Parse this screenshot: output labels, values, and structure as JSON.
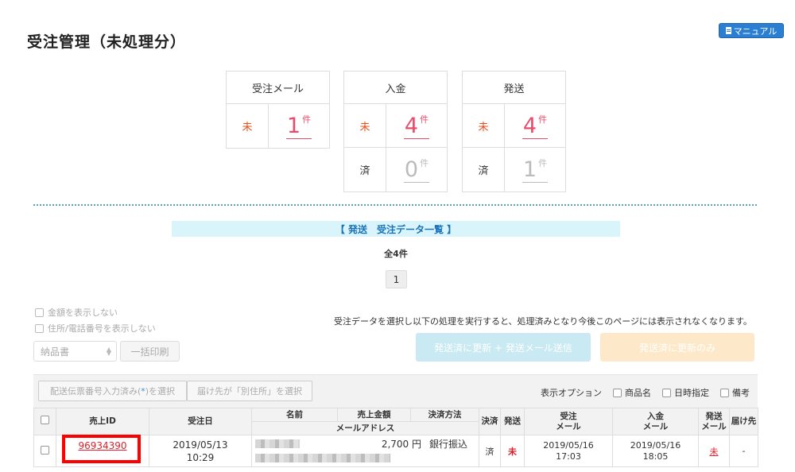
{
  "page_title": "受注管理（未処理分）",
  "manual_button": "マニュアル",
  "stats": [
    {
      "header": "受注メール",
      "rows": [
        {
          "label": "未",
          "value": "1",
          "unit": "件",
          "state": "red"
        }
      ]
    },
    {
      "header": "入金",
      "rows": [
        {
          "label": "未",
          "value": "4",
          "unit": "件",
          "state": "red"
        },
        {
          "label": "済",
          "value": "0",
          "unit": "件",
          "state": "gray"
        }
      ]
    },
    {
      "header": "発送",
      "rows": [
        {
          "label": "未",
          "value": "4",
          "unit": "件",
          "state": "red"
        },
        {
          "label": "済",
          "value": "1",
          "unit": "件",
          "state": "gray"
        }
      ]
    }
  ],
  "list_heading": "【 発送　受注データ一覧 】",
  "total_count": "全4件",
  "pagination": {
    "current": "1"
  },
  "options": {
    "hide_amount": "金額を表示しない",
    "hide_address": "住所/電話番号を表示しない"
  },
  "print": {
    "select_value": "納品書",
    "button": "一括印刷"
  },
  "notice": "受注データを選択し以下の処理を実行すると、処理済みとなり今後このページには表示されなくなります。",
  "actions": {
    "update_and_mail": "発送済に更新 + 発送メール送信",
    "update_only": "発送済に更新のみ"
  },
  "toolbar": {
    "select_tracking_pre": "配送伝票番号入力済み(",
    "select_tracking_star": "*",
    "select_tracking_post": ")を選択",
    "select_other_address": "届け先が「別住所」を選択"
  },
  "display_options": {
    "label": "表示オプション",
    "items": [
      "商品名",
      "日時指定",
      "備考"
    ]
  },
  "table": {
    "headers": {
      "sale_id": "売上ID",
      "order_date": "受注日",
      "name": "名前",
      "amount": "売上金額",
      "payment_method": "決済方法",
      "email": "メールアドレス",
      "settled": "決済",
      "shipped": "発送",
      "order_mail_1": "受注",
      "order_mail_2": "メール",
      "payment_mail_1": "入金",
      "payment_mail_2": "メール",
      "ship_mail_1": "発送",
      "ship_mail_2": "メール",
      "destination": "届け先"
    },
    "rows": [
      {
        "sale_id": "96934390",
        "order_date": "2019/05/13",
        "order_time": "10:29",
        "amount": "2,700 円",
        "payment_method": "銀行振込",
        "settled": "済",
        "shipped": "未",
        "order_mail_date": "2019/05/16",
        "order_mail_time": "17:03",
        "payment_mail_date": "2019/05/16",
        "payment_mail_time": "18:05",
        "ship_mail": "未",
        "destination": "-"
      }
    ]
  }
}
